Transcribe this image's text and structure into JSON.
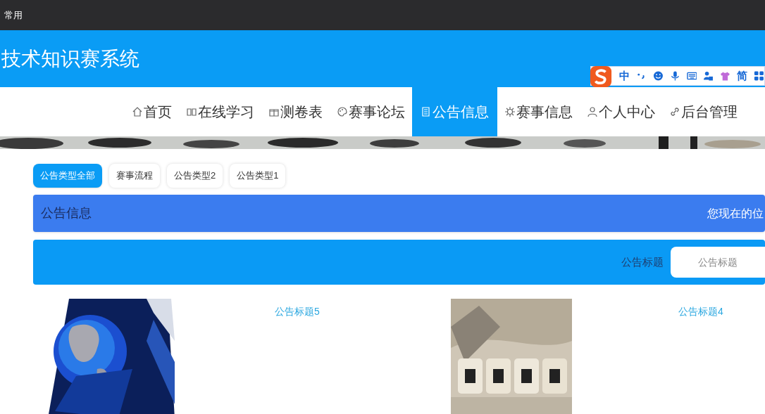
{
  "bookmarks_bar": {
    "items": [
      "常用"
    ]
  },
  "header": {
    "title": "技术知识赛系统"
  },
  "nav": [
    {
      "label": "首页",
      "selected": false
    },
    {
      "label": "在线学习",
      "selected": false
    },
    {
      "label": "测卷表",
      "selected": false
    },
    {
      "label": "赛事论坛",
      "selected": false
    },
    {
      "label": "公告信息",
      "selected": true
    },
    {
      "label": "赛事信息",
      "selected": false
    },
    {
      "label": "个人中心",
      "selected": false
    },
    {
      "label": "后台管理",
      "selected": false
    }
  ],
  "ime_toolbar": {
    "mode": "中",
    "script": "简"
  },
  "filter_tabs": [
    {
      "label": "公告类型全部",
      "selected": true
    },
    {
      "label": "赛事流程",
      "selected": false
    },
    {
      "label": "公告类型2",
      "selected": false
    },
    {
      "label": "公告类型1",
      "selected": false
    }
  ],
  "breadcrumb_bar": {
    "title": "公告信息",
    "location": "您现在的位"
  },
  "search": {
    "label": "公告标题",
    "placeholder": "公告标题"
  },
  "cards": [
    {
      "title": "公告标题5"
    },
    {
      "title": "公告标题4"
    }
  ]
}
